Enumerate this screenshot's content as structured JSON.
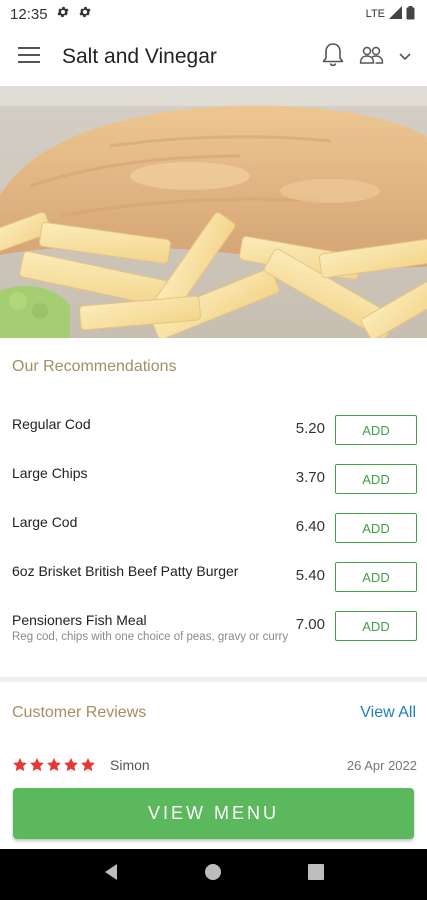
{
  "status_bar": {
    "time": "12:35",
    "network": "LTE"
  },
  "app_bar": {
    "title": "Salt and Vinegar"
  },
  "recommendations": {
    "title": "Our Recommendations",
    "items": [
      {
        "name": "Regular Cod",
        "description": "",
        "price": "5.20",
        "button": "ADD"
      },
      {
        "name": "Large Chips",
        "description": "",
        "price": "3.70",
        "button": "ADD"
      },
      {
        "name": "Large Cod",
        "description": "",
        "price": "6.40",
        "button": "ADD"
      },
      {
        "name": "6oz Brisket British Beef Patty Burger",
        "description": "",
        "price": "5.40",
        "button": "ADD"
      },
      {
        "name": "Pensioners Fish Meal",
        "description": "Reg cod, chips with one choice of peas, gravy or curry",
        "price": "7.00",
        "button": "ADD"
      }
    ]
  },
  "reviews": {
    "title": "Customer Reviews",
    "view_all": "View All",
    "items": [
      {
        "rating": 5,
        "name": "Simon",
        "date": "26 Apr 2022"
      }
    ]
  },
  "view_menu_button": "VIEW MENU",
  "colors": {
    "accent_gold": "#a48e63",
    "add_green": "#43a047",
    "cta_green": "#5cb85c",
    "link_blue": "#1f7fbf",
    "star_red": "#e53935"
  }
}
